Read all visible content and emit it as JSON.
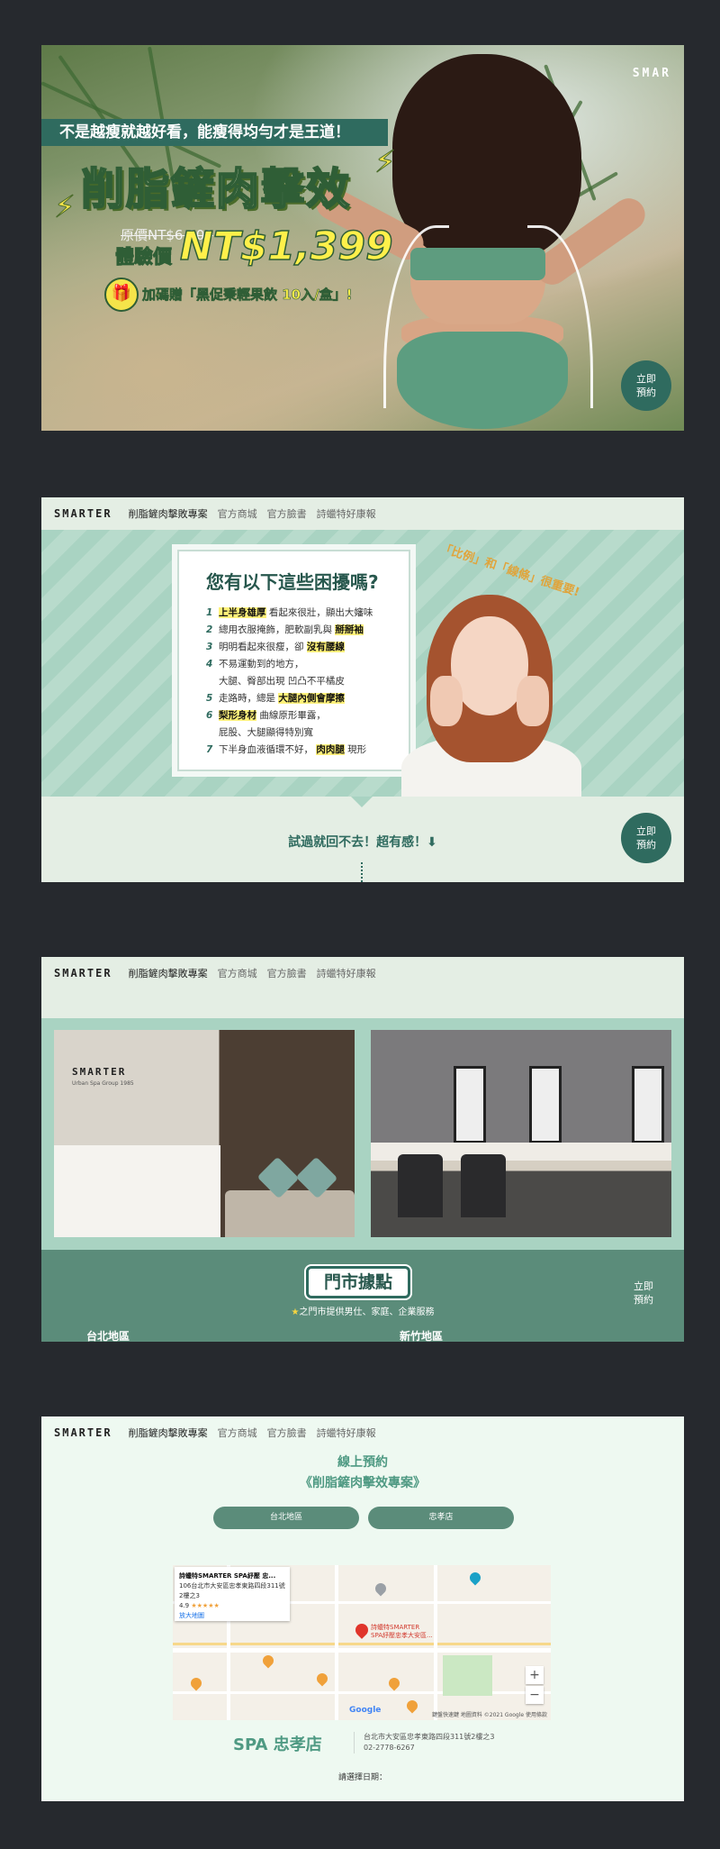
{
  "brand": "SMARTER",
  "nav": {
    "items": [
      "削脂鏟肉擊敗專案",
      "官方商城",
      "官方臉書",
      "詩蠟特好康報"
    ]
  },
  "hero": {
    "brand_partial": "SMAR",
    "tagline": "不是越瘦就越好看，能瘦得均勻才是王道！",
    "title": "削脂鏟肉擊效",
    "original_price": "原價NT$6,000",
    "experience_label": "體驗價",
    "experience_price": "NT$1,399",
    "gift_text": "加碼贈「黑促秉輕果飲 10入/盒」!",
    "book_line1": "立即",
    "book_line2": "預約"
  },
  "problems": {
    "heading": "您有以下這些困擾嗎?",
    "badge": "「比例」和「線條」很重要!",
    "items": [
      {
        "n": "1",
        "pre": "",
        "hl": "上半身雄厚",
        "post": " 看起來很壯，顯出大嬸味"
      },
      {
        "n": "2",
        "pre": "總用衣服掩飾，肥軟副乳與 ",
        "hl": "掰掰袖",
        "post": ""
      },
      {
        "n": "3",
        "pre": "明明看起來很瘦，卻 ",
        "hl": "沒有腰線",
        "post": ""
      },
      {
        "n": "4",
        "pre": "不易運動到的地方，",
        "hl": "",
        "post": ""
      },
      {
        "n": "",
        "pre": "大腿、臀部出現 凹凸不平橘皮",
        "hl": "",
        "post": ""
      },
      {
        "n": "5",
        "pre": "走路時，總是 ",
        "hl": "大腿內側會摩擦",
        "post": ""
      },
      {
        "n": "6",
        "pre": "",
        "hl": "梨形身材",
        "post": " 曲線原形畢露，"
      },
      {
        "n": "",
        "pre": "屁股、大腿顯得特別寬",
        "hl": "",
        "post": ""
      },
      {
        "n": "7",
        "pre": "下半身血液循環不好， ",
        "hl": "肉肉腿",
        "post": " 現形"
      }
    ],
    "cta": "試過就回不去！超有感！",
    "cta_arrow": "⬇"
  },
  "stores": {
    "title": "門市據點",
    "subtitle": "之門市提供男仕、家庭、企業服務",
    "star": "★",
    "regions": [
      "台北地區",
      "新竹地區"
    ],
    "wall_logo": "SMARTER",
    "wall_sub": "Urban Spa Group 1985",
    "book_line1": "立即",
    "book_line2": "預約"
  },
  "reservation": {
    "title_line1": "線上預約",
    "title_line2": "《削脂鏟肉擊效專案》",
    "buttons": [
      "台北地區",
      "忠孝店"
    ],
    "map": {
      "card_title": "詩蠟特SMARTER SPA紓壓 忠...",
      "card_addr": "106台北市大安區忠孝東路四段311號",
      "card_floor": "2樓之3",
      "card_rating": "4.9",
      "card_stars": "★★★★★",
      "card_link": "放大地圖",
      "pin_label_1": "詩蠟特SMARTER",
      "pin_label_2": "SPA紓壓忠孝大安區...",
      "zoom_in": "+",
      "zoom_out": "−",
      "google": "Google",
      "footer": "鍵盤快速鍵  地圖資料 ©2021 Google  使用條款"
    },
    "store_name": "SPA 忠孝店",
    "address": "台北市大安區忠孝東路四段311號2樓之3",
    "phone": "02-2778-6267",
    "date_label": "請選擇日期："
  },
  "colors": {
    "page_bg": "#26292e",
    "brand_green": "#2f6b5f",
    "mint": "#a9d3c2",
    "accent_yellow": "#fff04a"
  }
}
